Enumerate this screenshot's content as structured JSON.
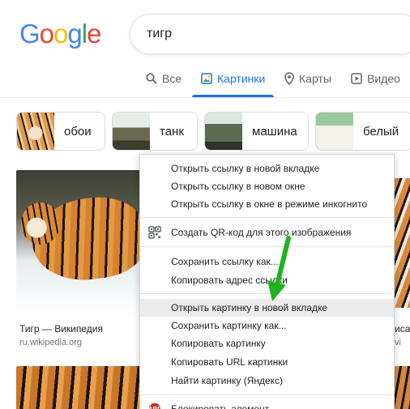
{
  "logo": {
    "letters": [
      "G",
      "o",
      "o",
      "g",
      "l",
      "e"
    ],
    "colors": [
      "#4285f4",
      "#ea4335",
      "#fbbc05",
      "#4285f4",
      "#34a853",
      "#ea4335"
    ]
  },
  "search": {
    "query": "тигр"
  },
  "tabs": [
    {
      "label": "Все",
      "icon": "search-icon",
      "active": false
    },
    {
      "label": "Картинки",
      "icon": "image-icon",
      "active": true
    },
    {
      "label": "Карты",
      "icon": "map-pin-icon",
      "active": false
    },
    {
      "label": "Видео",
      "icon": "video-icon",
      "active": false
    }
  ],
  "chips": [
    {
      "label": "обои",
      "thumb": "tiger-face-thumb"
    },
    {
      "label": "танк",
      "thumb": "tank-thumb"
    },
    {
      "label": "машина",
      "thumb": "military-car-thumb"
    },
    {
      "label": "белый",
      "thumb": "white-tigers-thumb"
    }
  ],
  "results": [
    {
      "title": "Тигр — Википедия",
      "source": "ru.wikipedia.org"
    },
    {
      "title": "иса",
      "source": "vi"
    }
  ],
  "context_menu": {
    "items": [
      {
        "label": "Открыть ссылку в новой вкладке",
        "group": 1
      },
      {
        "label": "Открыть ссылку в новом окне",
        "group": 1
      },
      {
        "label": "Открыть ссылку в окне в режиме инкогнито",
        "group": 1
      },
      {
        "label": "Создать QR-код для этого изображения",
        "group": 2,
        "icon": "qr-code-icon"
      },
      {
        "label": "Сохранить ссылку как...",
        "group": 3
      },
      {
        "label": "Копировать адрес ссылки",
        "group": 3
      },
      {
        "label": "Открыть картинку в новой вкладке",
        "group": 4,
        "highlighted": true
      },
      {
        "label": "Сохранить картинку как...",
        "group": 4
      },
      {
        "label": "Копировать картинку",
        "group": 4
      },
      {
        "label": "Копировать URL картинки",
        "group": 4
      },
      {
        "label": "Найти картинку (Яндекс)",
        "group": 4
      },
      {
        "label": "Блокировать элемент...",
        "group": 5,
        "icon": "adblock-icon"
      }
    ]
  },
  "colors": {
    "accent": "#1a73e8",
    "arrow": "#22b21e",
    "highlight": "#ebebeb"
  }
}
